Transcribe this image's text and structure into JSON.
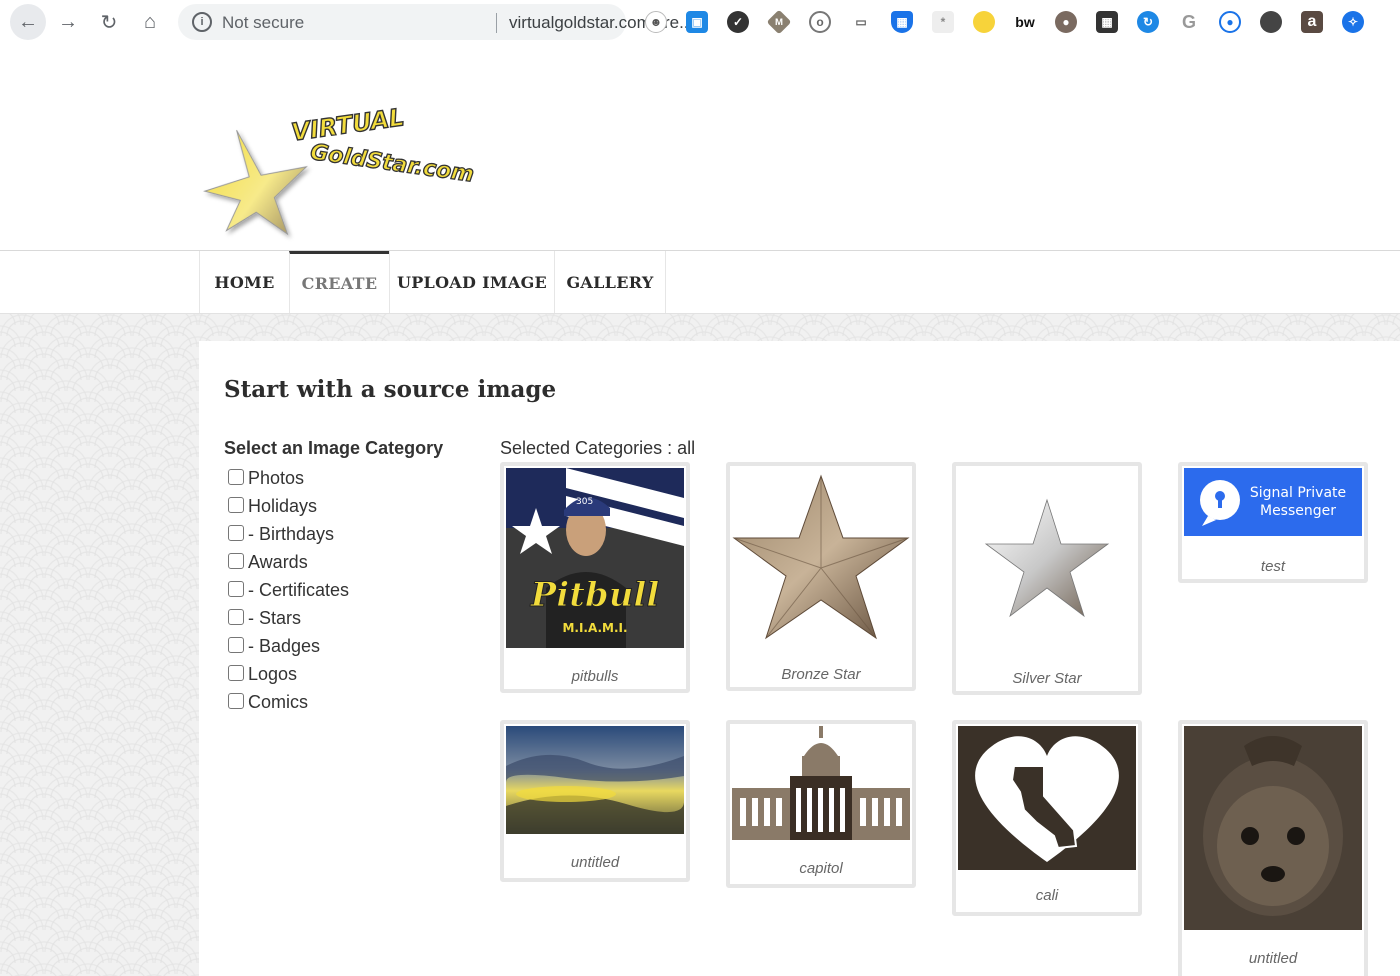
{
  "browser": {
    "security_label": "Not secure",
    "url": "virtualgoldstar.com/cre...",
    "extensions": [
      "ghost-ext-icon",
      "window-ext-icon",
      "check-ext-icon",
      "m-ext-icon",
      "ring-ext-icon",
      "laptop-ext-icon",
      "shield-ext-icon",
      "keys-ext-icon",
      "honey-ext-icon",
      "bw-ext-icon",
      "person-ext-icon",
      "calculator-ext-icon",
      "sync-ext-icon",
      "google-ext-icon",
      "lock-ext-icon",
      "circle-ext-icon",
      "a-ext-icon",
      "compass-ext-icon"
    ],
    "extension_texts": {
      "bw": "bw",
      "a": "a"
    }
  },
  "logo": {
    "line1": "VIRTUAL",
    "line2": "GoldStar.com"
  },
  "nav": {
    "home": "HOME",
    "create": "CREATE",
    "upload": "UPLOAD IMAGE",
    "gallery": "GALLERY"
  },
  "main": {
    "title": "Start with a source image",
    "category_heading": "Select an Image Category",
    "categories": [
      "Photos",
      "Holidays",
      "- Birthdays",
      "Awards",
      "- Certificates",
      "- Stars",
      "- Badges",
      "Logos",
      "Comics"
    ],
    "selected_label": "Selected Categories : all"
  },
  "gallery": {
    "captions": [
      "pitbulls",
      "Bronze Star",
      "Silver Star",
      "test",
      "untitled",
      "capitol",
      "cali",
      "untitled"
    ],
    "pitbull_text": "Pitbull",
    "pitbull_sub": "M.I.A.M.I.",
    "pitbull_cap": "305",
    "signal_line1": "Signal Private",
    "signal_line2": "Messenger"
  },
  "colors": {
    "accent_nav_border": "#333333",
    "signal_blue": "#2c6bed",
    "gold": "#f2dc3c"
  }
}
